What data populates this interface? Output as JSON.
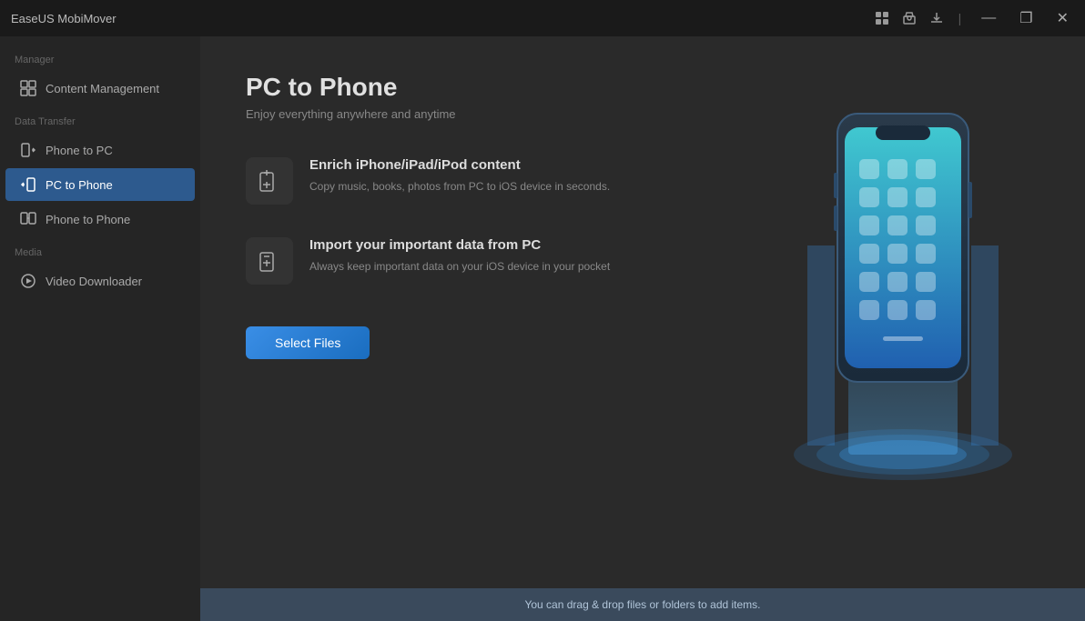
{
  "titleBar": {
    "appName": "EaseUS MobiMover",
    "icons": [
      "grid-icon",
      "shop-icon",
      "download-icon"
    ],
    "windowControls": {
      "minimize": "—",
      "maximize": "❐",
      "close": "✕"
    }
  },
  "sidebar": {
    "sections": [
      {
        "label": "Manager",
        "items": [
          {
            "id": "content-management",
            "label": "Content Management",
            "active": false
          }
        ]
      },
      {
        "label": "Data Transfer",
        "items": [
          {
            "id": "phone-to-pc",
            "label": "Phone to PC",
            "active": false
          },
          {
            "id": "pc-to-phone",
            "label": "PC to Phone",
            "active": true
          },
          {
            "id": "phone-to-phone",
            "label": "Phone to Phone",
            "active": false
          }
        ]
      },
      {
        "label": "Media",
        "items": [
          {
            "id": "video-downloader",
            "label": "Video Downloader",
            "active": false
          }
        ]
      }
    ]
  },
  "content": {
    "title": "PC to Phone",
    "subtitle": "Enjoy everything anywhere and anytime",
    "features": [
      {
        "id": "enrich",
        "title": "Enrich iPhone/iPad/iPod content",
        "description": "Copy music, books, photos from PC to iOS device in seconds."
      },
      {
        "id": "import",
        "title": "Import your important data from PC",
        "description": "Always keep important data on your iOS device in your pocket"
      }
    ],
    "selectFilesButton": "Select Files"
  },
  "bottomBar": {
    "message": "You can drag & drop files or folders to add items."
  }
}
